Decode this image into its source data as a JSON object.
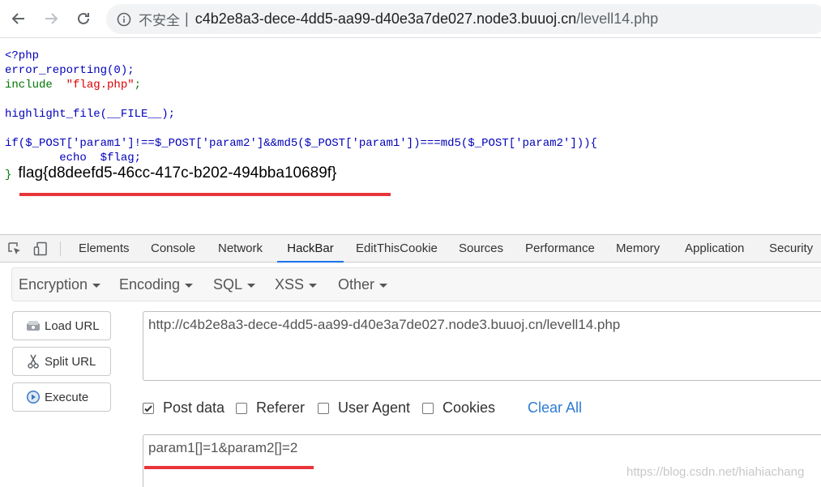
{
  "browser": {
    "security_label": "不安全",
    "separator": "|",
    "url_host": "c4b2e8a3-dece-4dd5-aa99-d40e3a7de027.node3.buuoj.cn",
    "url_path": "/levell14.php"
  },
  "page": {
    "code_lines": [
      "<?php",
      "error_reporting(0);",
      "include  \"flag.php\";",
      "",
      "highlight_file(__FILE__);",
      "",
      "if($_POST['param1']!==$_POST['param2']&&md5($_POST['param1'])===md5($_POST['param2'])){",
      "        echo  $flag;"
    ],
    "closing_brace": "}",
    "flag": "flag{d8deefd5-46cc-417c-b202-494bba10689f}"
  },
  "devtools": {
    "tabs": [
      "Elements",
      "Console",
      "Network",
      "HackBar",
      "EditThisCookie",
      "Sources",
      "Performance",
      "Memory",
      "Application",
      "Security"
    ],
    "active_tab": "HackBar"
  },
  "hackbar": {
    "menus": [
      "Encryption",
      "Encoding",
      "SQL",
      "XSS",
      "Other"
    ],
    "buttons": {
      "load_url": "Load URL",
      "split_url": "Split URL",
      "execute": "Execute"
    },
    "url_value": "http://c4b2e8a3-dece-4dd5-aa99-d40e3a7de027.node3.buuoj.cn/levell14.php",
    "checkboxes": [
      {
        "label": "Post data",
        "checked": true
      },
      {
        "label": "Referer",
        "checked": false
      },
      {
        "label": "User Agent",
        "checked": false
      },
      {
        "label": "Cookies",
        "checked": false
      }
    ],
    "clear_all": "Clear All",
    "post_value": "param1[]=1&param2[]=2"
  },
  "watermark": "https://blog.csdn.net/hiahiachang",
  "colors": {
    "highlight_underline": "#e8353b",
    "active_tab": "#1a73e8",
    "link": "#2f7bd2"
  }
}
